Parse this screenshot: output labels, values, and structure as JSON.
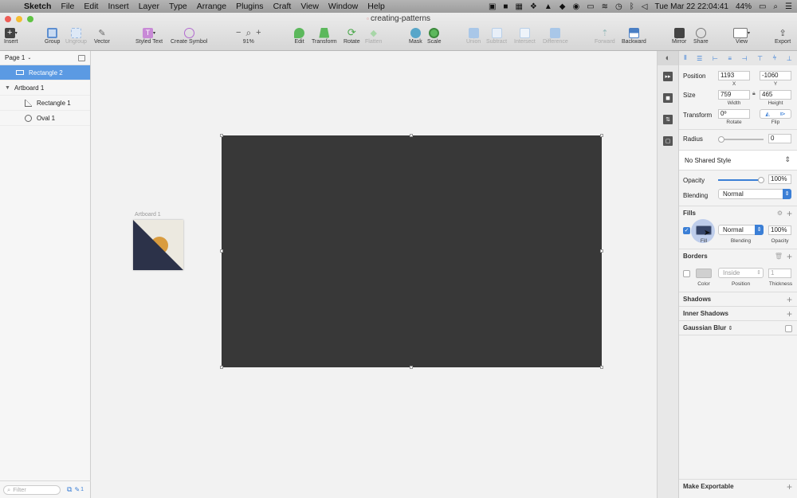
{
  "menubar": {
    "app": "Sketch",
    "items": [
      "File",
      "Edit",
      "Insert",
      "Layer",
      "Type",
      "Arrange",
      "Plugins",
      "Craft",
      "View",
      "Window",
      "Help"
    ],
    "clock": "Tue Mar 22  22:04:41",
    "battery": "44%"
  },
  "window": {
    "title": "creating-patterns"
  },
  "toolbar": {
    "insert": "Insert",
    "group": "Group",
    "ungroup": "Ungroup",
    "vector": "Vector",
    "styled_text": "Styled Text",
    "create_symbol": "Create Symbol",
    "zoom": "91%",
    "zoom_minus": "−",
    "zoom_plus": "+",
    "edit": "Edit",
    "transform": "Transform",
    "rotate": "Rotate",
    "flatten": "Flatten",
    "mask": "Mask",
    "scale": "Scale",
    "union": "Union",
    "subtract": "Subtract",
    "intersect": "Intersect",
    "difference": "Difference",
    "forward": "Forward",
    "backward": "Backward",
    "mirror": "Mirror",
    "share": "Share",
    "view": "View",
    "export": "Export"
  },
  "layers": {
    "page": "Page 1",
    "items": [
      {
        "name": "Rectangle 2"
      },
      {
        "name": "Artboard 1"
      },
      {
        "name": "Rectangle 1"
      },
      {
        "name": "Oval 1"
      }
    ],
    "filter_placeholder": "Filter",
    "count": "1"
  },
  "canvas": {
    "artboard_label": "Artboard 1",
    "colors": {
      "rect": "#383838",
      "navy": "#2c3249",
      "orange": "#d99c3f",
      "cream": "#ece9e0"
    }
  },
  "inspector": {
    "position_label": "Position",
    "x": "1193",
    "y": "-1060",
    "x_label": "X",
    "y_label": "Y",
    "size_label": "Size",
    "width": "759",
    "height": "465",
    "width_label": "Width",
    "height_label": "Height",
    "transform_label": "Transform",
    "rotate": "0º",
    "rotate_label": "Rotate",
    "flip_label": "Flip",
    "radius_label": "Radius",
    "radius": "0",
    "shared_style": "No Shared Style",
    "opacity_label": "Opacity",
    "opacity": "100%",
    "blending_label": "Blending",
    "blending": "Normal",
    "fills_title": "Fills",
    "fill_blend": "Normal",
    "fill_opacity": "100%",
    "fill_label": "Fill",
    "fill_blending_label": "Blending",
    "fill_opacity_label": "Opacity",
    "borders_title": "Borders",
    "border_position": "Inside",
    "border_thickness": "1",
    "border_color_label": "Color",
    "border_position_label": "Position",
    "border_thickness_label": "Thickness",
    "shadows_title": "Shadows",
    "inner_shadows_title": "Inner Shadows",
    "blur_title": "Gaussian Blur",
    "make_exportable": "Make Exportable"
  }
}
